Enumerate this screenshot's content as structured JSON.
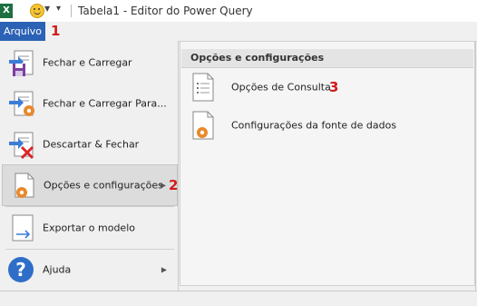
{
  "titlebar": {
    "app_icon": "excel-icon",
    "app_letter": "X",
    "title": "Tabela1 - Editor do Power Query"
  },
  "menubar": {
    "file_tab": "Arquivo",
    "marker": "1"
  },
  "left_menu": {
    "items": [
      {
        "label": "Fechar e Carregar",
        "icon": "close-and-load-icon"
      },
      {
        "label": "Fechar e Carregar Para...",
        "icon": "close-and-load-to-icon"
      },
      {
        "label": "Descartar & Fechar",
        "icon": "discard-and-close-icon"
      },
      {
        "label": "Opções e configurações",
        "icon": "options-settings-icon",
        "marker": "2"
      },
      {
        "label": "Exportar o modelo",
        "icon": "export-template-icon"
      },
      {
        "label": "Ajuda",
        "icon": "help-icon"
      }
    ]
  },
  "right_panel": {
    "heading": "Opções e configurações",
    "items": [
      {
        "label": "Opções de Consulta",
        "icon": "query-options-icon",
        "marker": "3"
      },
      {
        "label": "Configurações da fonte de dados",
        "icon": "data-source-settings-icon"
      }
    ]
  },
  "colors": {
    "accent": "#2b62b5",
    "marker": "#d01a1a",
    "gear": "#e8892b"
  }
}
